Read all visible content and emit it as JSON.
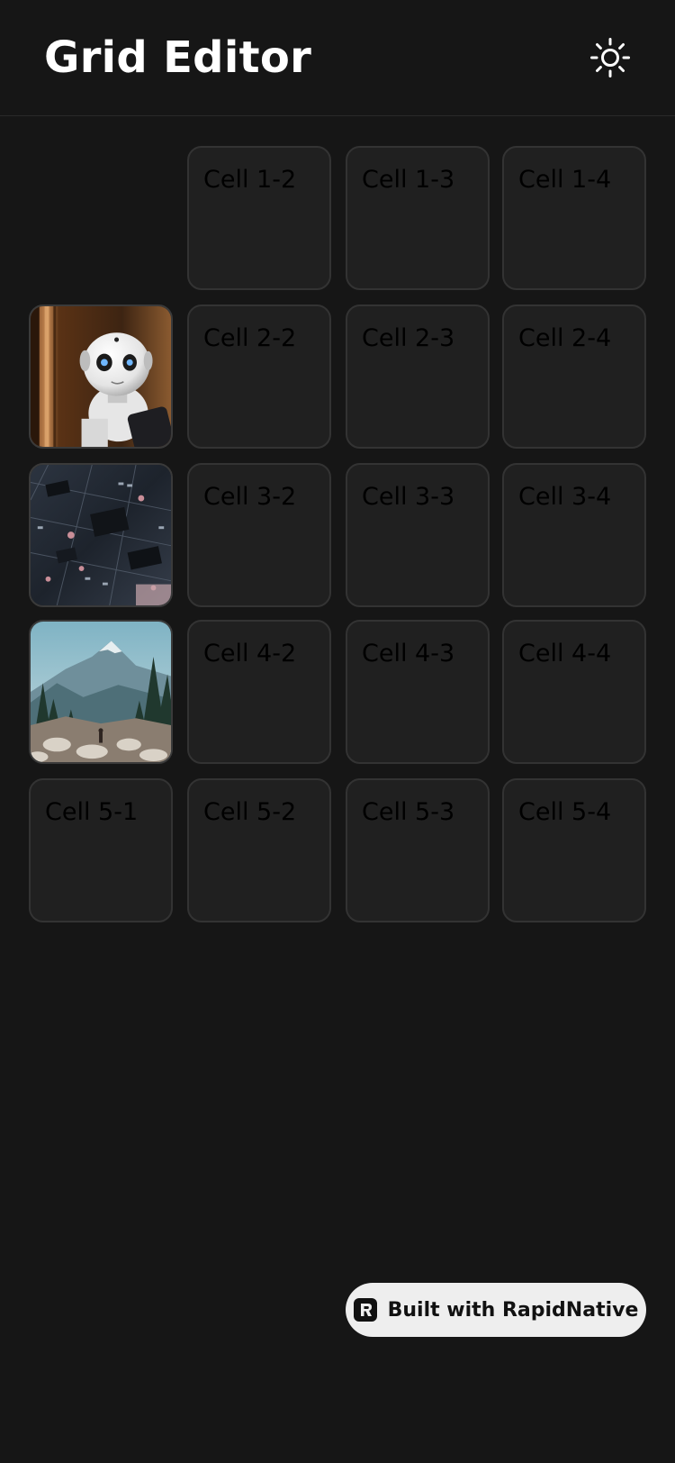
{
  "header": {
    "title": "Grid Editor",
    "theme_toggle_icon": "sun-icon"
  },
  "grid": {
    "rows": [
      {
        "cells": [
          {
            "type": "empty",
            "label": ""
          },
          {
            "type": "text",
            "label": "Cell 1-2"
          },
          {
            "type": "text",
            "label": "Cell 1-3"
          },
          {
            "type": "text",
            "label": "Cell 1-4"
          }
        ]
      },
      {
        "cells": [
          {
            "type": "image",
            "image": "robot-photo"
          },
          {
            "type": "text",
            "label": "Cell 2-2"
          },
          {
            "type": "text",
            "label": "Cell 2-3"
          },
          {
            "type": "text",
            "label": "Cell 2-4"
          }
        ]
      },
      {
        "cells": [
          {
            "type": "image",
            "image": "circuit-board-photo"
          },
          {
            "type": "text",
            "label": "Cell 3-2"
          },
          {
            "type": "text",
            "label": "Cell 3-3"
          },
          {
            "type": "text",
            "label": "Cell 3-4"
          }
        ]
      },
      {
        "cells": [
          {
            "type": "image",
            "image": "mountain-landscape-photo"
          },
          {
            "type": "text",
            "label": "Cell 4-2"
          },
          {
            "type": "text",
            "label": "Cell 4-3"
          },
          {
            "type": "text",
            "label": "Cell 4-4"
          }
        ]
      },
      {
        "cells": [
          {
            "type": "text",
            "label": "Cell 5-1"
          },
          {
            "type": "text",
            "label": "Cell 5-2"
          },
          {
            "type": "text",
            "label": "Cell 5-3"
          },
          {
            "type": "text",
            "label": "Cell 5-4"
          }
        ]
      }
    ]
  },
  "badge": {
    "label": "Built with RapidNative",
    "icon": "rapidnative-logo-icon"
  },
  "colors": {
    "background": "#161616",
    "cell_background": "#202020",
    "cell_border": "#333333",
    "title": "#ffffff",
    "badge_background": "#eeeeee"
  }
}
